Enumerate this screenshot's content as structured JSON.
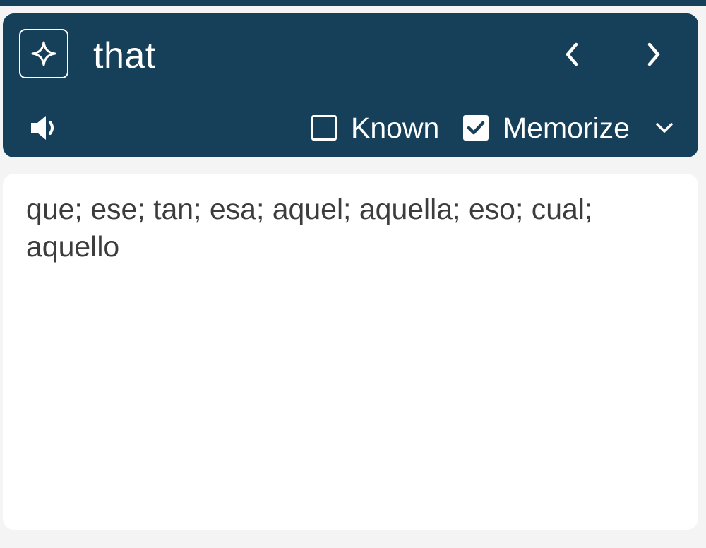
{
  "header": {
    "word": "that",
    "known_label": "Known",
    "known_checked": false,
    "memorize_label": "Memorize",
    "memorize_checked": true,
    "icons": {
      "ai": "sparkle-icon",
      "prev": "chevron-left-icon",
      "next": "chevron-right-icon",
      "speaker": "speaker-icon",
      "dropdown": "chevron-down-icon"
    }
  },
  "content": {
    "translation": "que; ese; tan; esa; aquel; aquella; eso; cual; aquello"
  },
  "colors": {
    "header_bg": "#16405a",
    "page_bg": "#f4f4f4",
    "card_bg": "#ffffff",
    "text": "#3c3c3c"
  }
}
